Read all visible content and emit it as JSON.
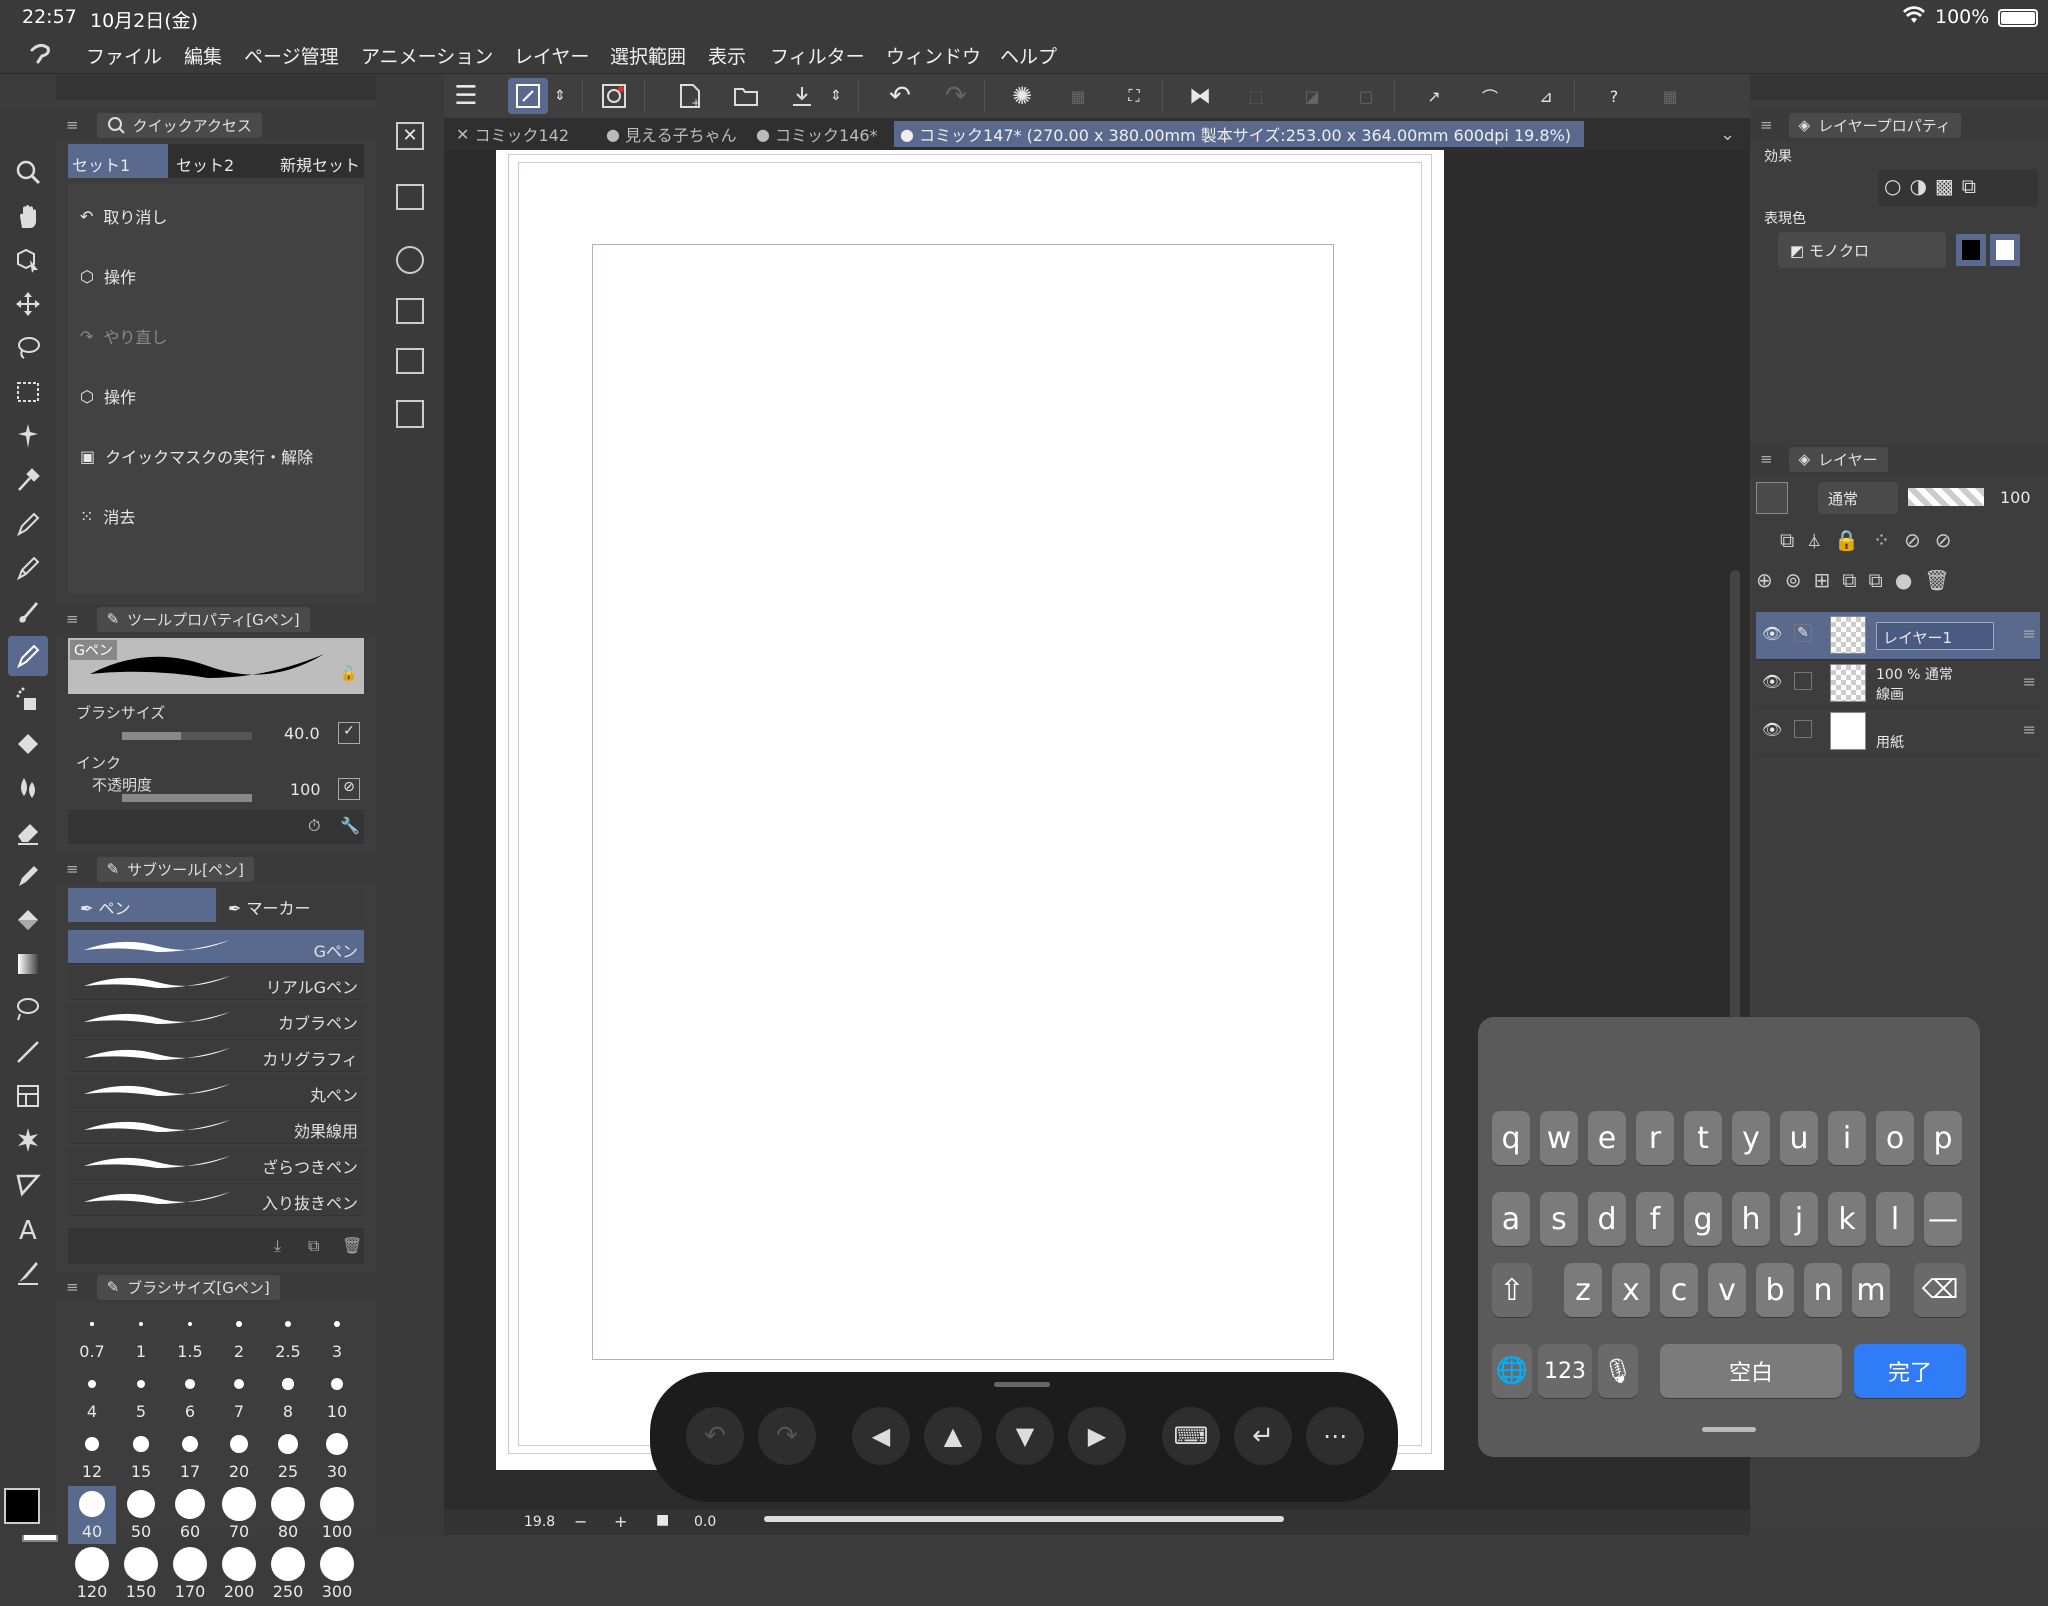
{
  "status": {
    "time": "22:57",
    "date": "10月2日(金)",
    "battery": "100%"
  },
  "menu": [
    "ファイル",
    "編集",
    "ページ管理",
    "アニメーション",
    "レイヤー",
    "選択範囲",
    "表示",
    "フィルター",
    "ウィンドウ",
    "ヘルプ"
  ],
  "tabs": [
    {
      "label": "コミック142",
      "closable": true
    },
    {
      "label": "見える子ちゃん"
    },
    {
      "label": "コミック146*"
    },
    {
      "label": "コミック147* (270.00 x 380.00mm 製本サイズ:253.00 x 364.00mm 600dpi 19.8%)",
      "active": true
    }
  ],
  "quick_access": {
    "title": "クイックアクセス",
    "sets": [
      "セット1",
      "セット2",
      "新規セット"
    ],
    "items": [
      "取り消し",
      "操作",
      "やり直し",
      "操作",
      "クイックマスクの実行・解除",
      "消去"
    ]
  },
  "tool_property": {
    "title": "ツールプロパティ[Gペン]",
    "preview_label": "Gペン",
    "brush_size_label": "ブラシサイズ",
    "brush_size_value": "40.0",
    "ink_label": "インク",
    "opacity_label": "不透明度",
    "opacity_value": "100"
  },
  "sub_tool": {
    "title": "サブツール[ペン]",
    "groups": [
      "ペン",
      "マーカー"
    ],
    "brushes": [
      "Gペン",
      "リアルGペン",
      "カブラペン",
      "カリグラフィ",
      "丸ペン",
      "効果線用",
      "ざらつきペン",
      "入り抜きペン"
    ]
  },
  "brush_size_panel": {
    "title": "ブラシサイズ[Gペン]",
    "sizes": [
      "0.7",
      "1",
      "1.5",
      "2",
      "2.5",
      "3",
      "4",
      "5",
      "6",
      "7",
      "8",
      "10",
      "12",
      "15",
      "17",
      "20",
      "25",
      "30",
      "40",
      "50",
      "60",
      "70",
      "80",
      "100",
      "120",
      "150",
      "170",
      "200",
      "250",
      "300"
    ],
    "selected": "40"
  },
  "layer_property": {
    "title": "レイヤープロパティ",
    "effect_label": "効果",
    "color_label": "表現色",
    "color_value": "モノクロ"
  },
  "layers_panel": {
    "title": "レイヤー",
    "blend_mode": "通常",
    "opacity": "100",
    "layers": [
      {
        "name": "レイヤー1",
        "meta": "100 % 通常",
        "editing": true
      },
      {
        "name": "線画",
        "meta": "100 % 通常"
      },
      {
        "name": "用紙",
        "meta": ""
      }
    ]
  },
  "canvas_footer": {
    "zoom": "19.8",
    "angle": "0.0"
  },
  "keyboard": {
    "row1": [
      "q",
      "w",
      "e",
      "r",
      "t",
      "y",
      "u",
      "i",
      "o",
      "p"
    ],
    "row2": [
      "a",
      "s",
      "d",
      "f",
      "g",
      "h",
      "j",
      "k",
      "l",
      "—"
    ],
    "row3": [
      "z",
      "x",
      "c",
      "v",
      "b",
      "n",
      "m"
    ],
    "num_label": "123",
    "space_label": "空白",
    "done_label": "完了"
  },
  "colors": {
    "accent": "#2f7cf6",
    "panel": "#3d3d3d",
    "canvas_bg": "#2c2c2c",
    "selected_row": "#5a6a8f"
  }
}
